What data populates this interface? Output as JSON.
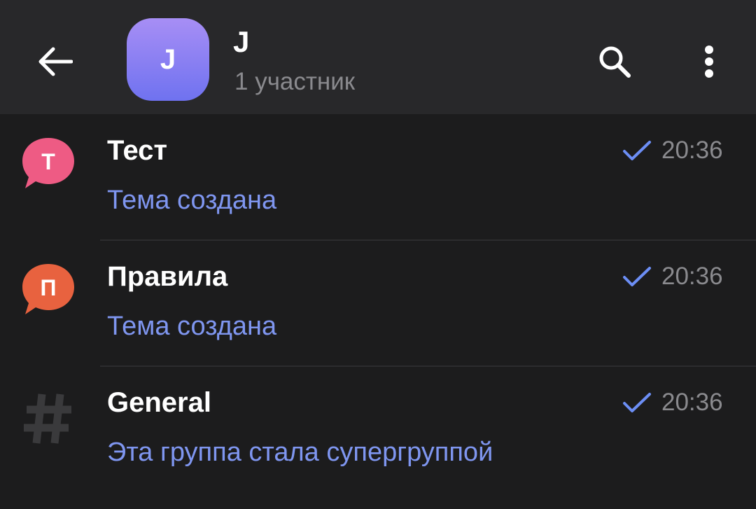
{
  "header": {
    "avatar_letter": "J",
    "title": "J",
    "subtitle": "1 участник"
  },
  "topics": [
    {
      "icon_letter": "Т",
      "icon_color": "#ee5b84",
      "name": "Тест",
      "message": "Тема создана",
      "time": "20:36",
      "status": "sent"
    },
    {
      "icon_letter": "П",
      "icon_color": "#e8623f",
      "name": "Правила",
      "message": "Тема создана",
      "time": "20:36",
      "status": "sent"
    },
    {
      "icon": "hash-icon",
      "name": "General",
      "message": "Эта группа стала супергруппой",
      "time": "20:36",
      "status": "sent"
    }
  ],
  "colors": {
    "background": "#1c1c1d",
    "header_background": "#28282a",
    "accent": "#7f96f0",
    "check": "#6c8ef5",
    "secondary_text": "#8a8a8e"
  }
}
